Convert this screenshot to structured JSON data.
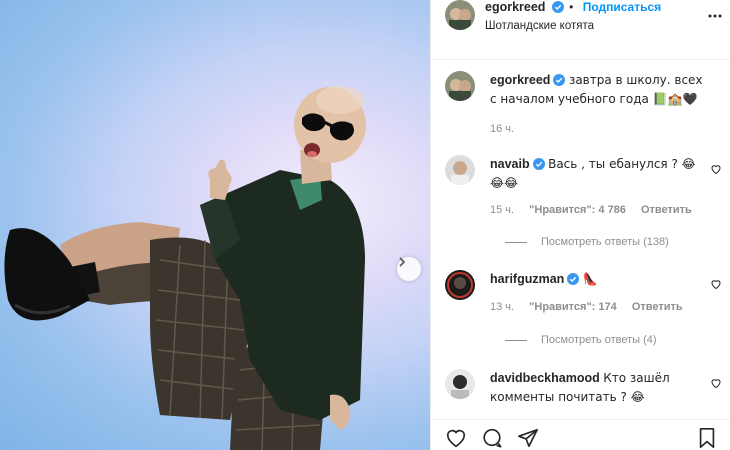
{
  "post": {
    "author": "egorkreed",
    "follow_label": "Подписаться",
    "separator": "•",
    "location": "Шотландские котята",
    "caption": "завтра в школу. всех с началом учебного года 📗🏫🖤",
    "caption_time": "16 ч."
  },
  "comments": [
    {
      "user": "navaib",
      "verified": true,
      "text": "Вась , ты ебанулся ? 😂😂😂",
      "time": "15 ч.",
      "likes": "\"Нравится\": 4 786",
      "reply_label": "Ответить",
      "view_replies": "Посмотреть ответы (138)"
    },
    {
      "user": "harifguzman",
      "verified": true,
      "text": "👠",
      "time": "13 ч.",
      "likes": "\"Нравится\": 174",
      "reply_label": "Ответить",
      "view_replies": "Посмотреть ответы (4)"
    },
    {
      "user": "davidbeckhamood",
      "verified": false,
      "text": "Кто зашёл комменты почитать ? 😂",
      "time": "",
      "likes": "",
      "reply_label": "",
      "view_replies": ""
    }
  ],
  "icons": {
    "verified": "verified-badge-icon",
    "more": "more-options-icon",
    "like": "heart-icon",
    "comment": "comment-icon",
    "share": "share-icon",
    "save": "bookmark-icon",
    "next": "chevron-right-icon"
  },
  "colors": {
    "accent": "#0095f6",
    "muted": "#8e8e8e",
    "text": "#262626",
    "border": "#efefef"
  }
}
